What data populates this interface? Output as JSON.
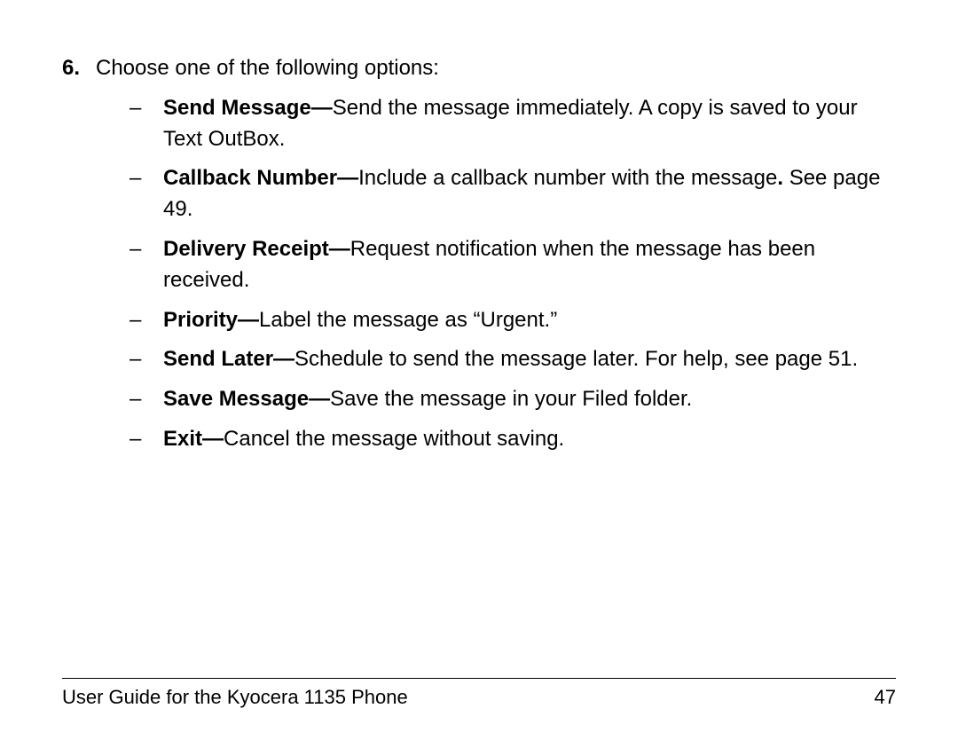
{
  "step": {
    "number": "6.",
    "text": "Choose one of the following options:"
  },
  "options": [
    {
      "label": "Send Message—",
      "text": "Send the message immediately. A copy is saved to your Text OutBox."
    },
    {
      "label": "Callback Number—",
      "text": "Include a callback number with the message",
      "boldPunct": ". ",
      "textAfter": "See page 49."
    },
    {
      "label": "Delivery Receipt—",
      "text": "Request notification when the message has been received."
    },
    {
      "label": "Priority—",
      "text": "Label the message as “Urgent.”"
    },
    {
      "label": "Send Later—",
      "text": "Schedule to send the message later. For help, see page 51."
    },
    {
      "label": "Save Message—",
      "text": "Save the message in your Filed folder."
    },
    {
      "label": "Exit—",
      "text": "Cancel the message without saving."
    }
  ],
  "footer": {
    "title": "User Guide for the Kyocera 1135 Phone",
    "page": "47"
  },
  "dash": "–"
}
